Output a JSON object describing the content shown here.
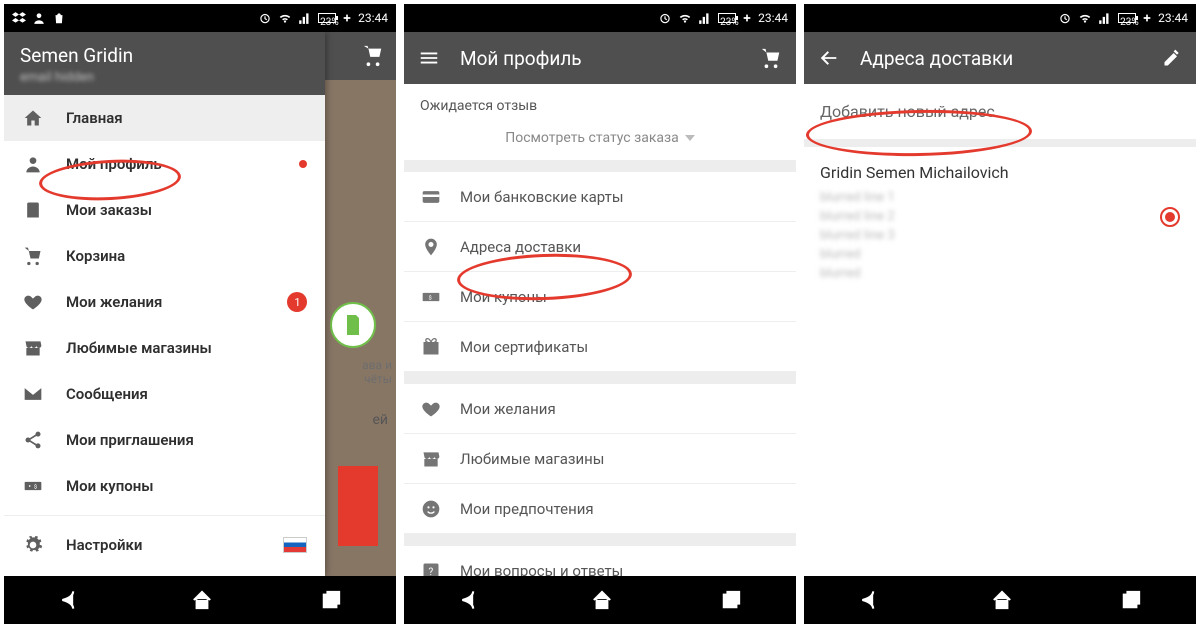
{
  "status": {
    "battery": "23%",
    "time": "23:44"
  },
  "navbuttons": {
    "back": "back-icon",
    "home": "home-icon",
    "recent": "recent-icon"
  },
  "phone1": {
    "drawer": {
      "user_name": "Semen Gridin",
      "user_sub": "email hidden",
      "items": [
        {
          "icon": "home-icon",
          "label": "Главная",
          "selected": true
        },
        {
          "icon": "user-icon",
          "label": "Мой профиль",
          "dot": true
        },
        {
          "icon": "clipboard-icon",
          "label": "Мои заказы"
        },
        {
          "icon": "cart-icon",
          "label": "Корзина"
        },
        {
          "icon": "heart-icon",
          "label": "Мои желания",
          "badge": "1"
        },
        {
          "icon": "store-icon",
          "label": "Любимые магазины"
        },
        {
          "icon": "mail-icon",
          "label": "Сообщения"
        },
        {
          "icon": "share-icon",
          "label": "Мои приглашения"
        },
        {
          "icon": "coupon-icon",
          "label": "Мои купоны"
        }
      ],
      "settings_label": "Настройки"
    },
    "behind": {
      "text1": "ава и",
      "text2": "чёты",
      "text3": "ей"
    }
  },
  "phone2": {
    "title": "Мой профиль",
    "pending_label": "Ожидается отзыв",
    "status_link": "Посмотреть статус заказа",
    "rows1": [
      {
        "icon": "card-icon",
        "label": "Мои банковские карты"
      },
      {
        "icon": "location-icon",
        "label": "Адреса доставки"
      },
      {
        "icon": "coupon-icon",
        "label": "Мои купоны"
      },
      {
        "icon": "gift-icon",
        "label": "Мои сертификаты"
      }
    ],
    "rows2": [
      {
        "icon": "heart-icon",
        "label": "Мои желания"
      },
      {
        "icon": "store-icon",
        "label": "Любимые магазины"
      },
      {
        "icon": "smile-icon",
        "label": "Мои предпочтения"
      }
    ],
    "rows3": [
      {
        "icon": "help-icon",
        "label": "Мои вопросы и ответы"
      }
    ]
  },
  "phone3": {
    "title": "Адреса доставки",
    "add_new": "Добавить новый адрес",
    "address": {
      "name": "Gridin Semen Michailovich",
      "lines": [
        "blurred line 1",
        "blurred line 2",
        "blurred line 3",
        "blurred",
        "blurred"
      ]
    }
  }
}
